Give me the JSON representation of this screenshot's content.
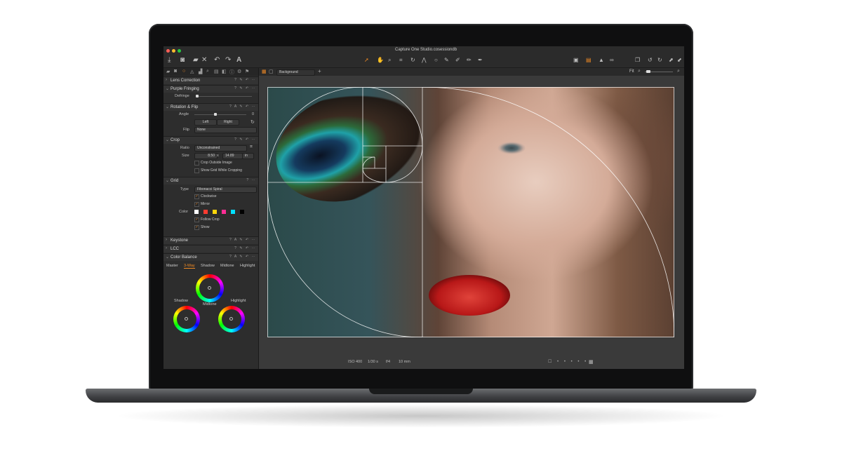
{
  "window": {
    "title": "Capture One Studio.cosessiondb"
  },
  "toolbar": {
    "left_icons": [
      "import-icon",
      "camera-icon",
      "folder-move-icon",
      "delete-icon",
      "undo-icon",
      "redo-icon",
      "text-icon"
    ],
    "center_icons": [
      "cursor-icon",
      "pan-icon",
      "loupe-icon",
      "crop-icon",
      "rotate-icon",
      "keystone-icon",
      "circle-icon",
      "picker-icon",
      "brush-icon",
      "eraser-icon",
      "gradient-icon"
    ],
    "right_icons": [
      "overlay-icon",
      "grid-icon",
      "warning-icon",
      "glasses-icon",
      "copy-icon",
      "reset-icon",
      "redo-all-icon",
      "apply-icon",
      "settings-icon"
    ]
  },
  "viewer": {
    "background_label": "Background",
    "zoom_label": "Fit",
    "status": {
      "iso": "ISO 400",
      "shutter": "1/30 s",
      "aperture": "f/4",
      "focal": "10 mm"
    }
  },
  "panel": {
    "lens_correction": {
      "title": "Lens Correction"
    },
    "purple_fringing": {
      "title": "Purple Fringing",
      "defringe_label": "Defringe"
    },
    "rotation_flip": {
      "title": "Rotation & Flip",
      "angle_label": "Angle",
      "angle_value": "0",
      "left_button": "Left",
      "right_button": "Right",
      "flip_label": "Flip",
      "flip_value": "None"
    },
    "crop": {
      "title": "Crop",
      "ratio_label": "Ratio",
      "ratio_value": "Unconstrained",
      "size_label": "Size",
      "width": "8.50",
      "x": "x",
      "height": "14.89",
      "unit": "in",
      "crop_outside": "Crop Outside Image",
      "show_grid": "Show Grid While Cropping"
    },
    "grid": {
      "title": "Grid",
      "type_label": "Type",
      "type_value": "Fibonacci Spiral",
      "clockwise": "Clockwise",
      "mirror": "Mirror",
      "color_label": "Color",
      "colors": [
        "#ffffff",
        "#ff3b30",
        "#ffd60a",
        "#ff2d95",
        "#00e0ff",
        "#000000"
      ],
      "follow_crop": "Follow Crop",
      "show": "Show"
    },
    "keystone": {
      "title": "Keystone"
    },
    "lcc": {
      "title": "LCC"
    },
    "color_balance": {
      "title": "Color Balance",
      "tabs": [
        "Master",
        "3-Way",
        "Shadow",
        "Midtone",
        "Highlight"
      ],
      "active_tab": "3-Way",
      "labels": {
        "shadow": "Shadow",
        "midtone": "Midtone",
        "highlight": "Highlight"
      }
    }
  },
  "colors": {
    "accent": "#f08a24",
    "panel": "#2d2d2d",
    "viewer": "#3a3a3a"
  }
}
